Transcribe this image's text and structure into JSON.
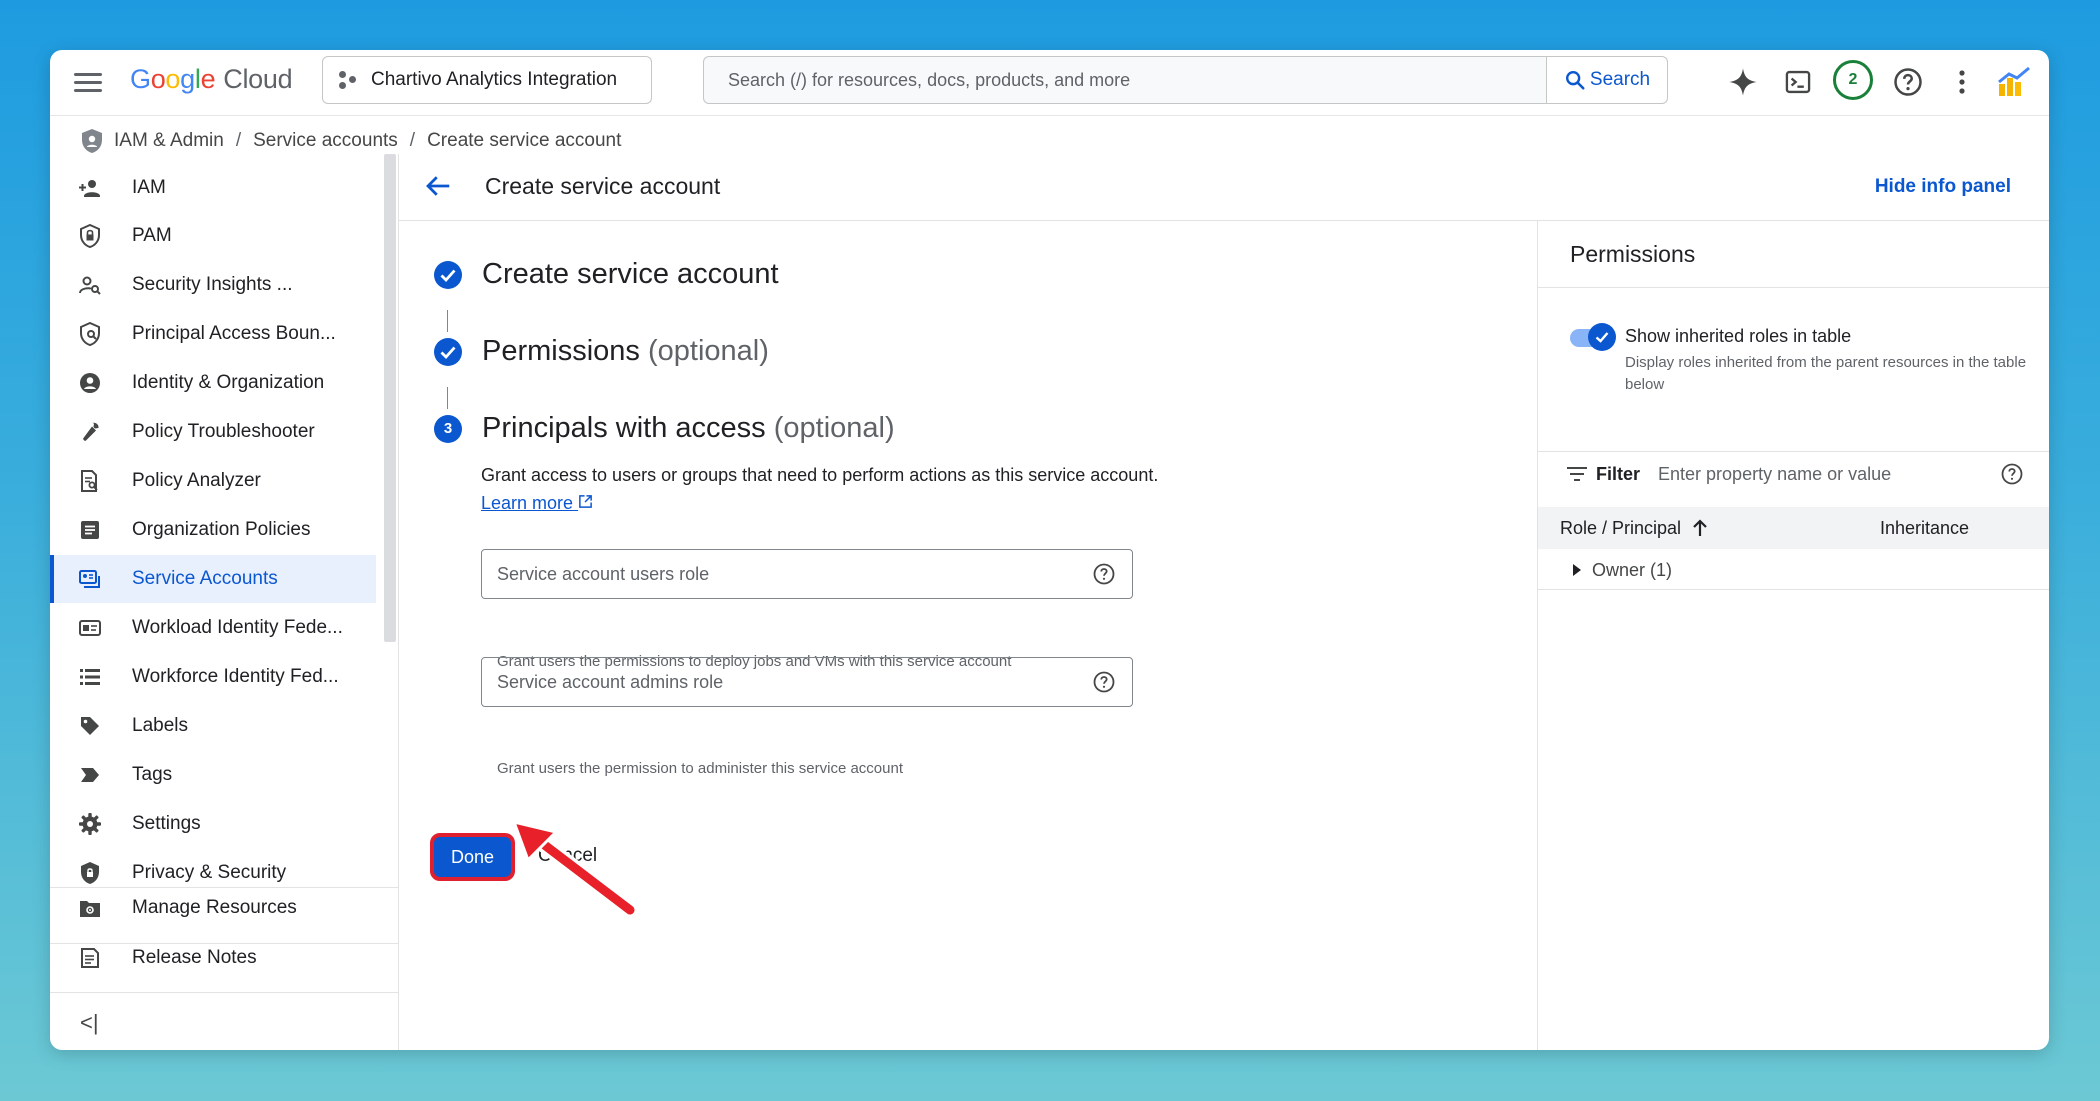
{
  "topbar": {
    "logo_google": "Google",
    "logo_cloud": "Cloud",
    "project_name": "Chartivo Analytics Integration",
    "search_placeholder": "Search (/) for resources, docs, products, and more",
    "search_button": "Search",
    "notifications_count": "2"
  },
  "breadcrumb": {
    "items": [
      "IAM & Admin",
      "Service accounts",
      "Create service account"
    ],
    "separator": "/"
  },
  "sidebar": {
    "items": [
      {
        "label": "IAM",
        "icon": "person-add-icon"
      },
      {
        "label": "PAM",
        "icon": "shield-lock-icon"
      },
      {
        "label": "Security Insights ...",
        "icon": "person-search-icon"
      },
      {
        "label": "Principal Access Boun...",
        "icon": "policy-shield-icon"
      },
      {
        "label": "Identity & Organization",
        "icon": "account-circle-icon"
      },
      {
        "label": "Policy Troubleshooter",
        "icon": "wrench-icon"
      },
      {
        "label": "Policy Analyzer",
        "icon": "document-search-icon"
      },
      {
        "label": "Organization Policies",
        "icon": "list-box-icon"
      },
      {
        "label": "Service Accounts",
        "icon": "service-account-icon"
      },
      {
        "label": "Workload Identity Fede...",
        "icon": "id-card-icon"
      },
      {
        "label": "Workforce Identity Fed...",
        "icon": "list-icon"
      },
      {
        "label": "Labels",
        "icon": "label-icon"
      },
      {
        "label": "Tags",
        "icon": "tag-icon"
      },
      {
        "label": "Settings",
        "icon": "gear-icon"
      },
      {
        "label": "Privacy & Security",
        "icon": "privacy-shield-icon"
      }
    ],
    "active_index": 8,
    "bottom": [
      {
        "label": "Manage Resources",
        "icon": "manage-resources-icon"
      },
      {
        "label": "Release Notes",
        "icon": "release-notes-icon"
      }
    ],
    "collapse_label": "<|"
  },
  "header": {
    "title": "Create service account",
    "hide_info": "Hide info panel"
  },
  "wizard": {
    "step1": "Create service account",
    "step2_title": "Permissions",
    "step2_optional": "(optional)",
    "step3_number": "3",
    "step3_title": "Principals with access",
    "step3_optional": "(optional)",
    "description": "Grant access to users or groups that need to perform actions as this service account.",
    "learn_more": "Learn more",
    "field_users_placeholder": "Service account users role",
    "field_users_hint": "Grant users the permissions to deploy jobs and VMs with this service account",
    "field_admins_placeholder": "Service account admins role",
    "field_admins_hint": "Grant users the permission to administer this service account",
    "done": "Done",
    "cancel": "Cancel"
  },
  "panel": {
    "title": "Permissions",
    "toggle_label": "Show inherited roles in table",
    "toggle_sub": "Display roles inherited from the parent resources in the table below",
    "toggle_on": true,
    "filter_label": "Filter",
    "filter_placeholder": "Enter property name or value",
    "col_role": "Role / Principal",
    "col_inheritance": "Inheritance",
    "rows": [
      "Owner (1)"
    ]
  },
  "colors": {
    "accent": "#0b57d0",
    "highlight_border": "#e0202e",
    "annotation_arrow": "#e8202a",
    "badge_green": "#188038"
  }
}
